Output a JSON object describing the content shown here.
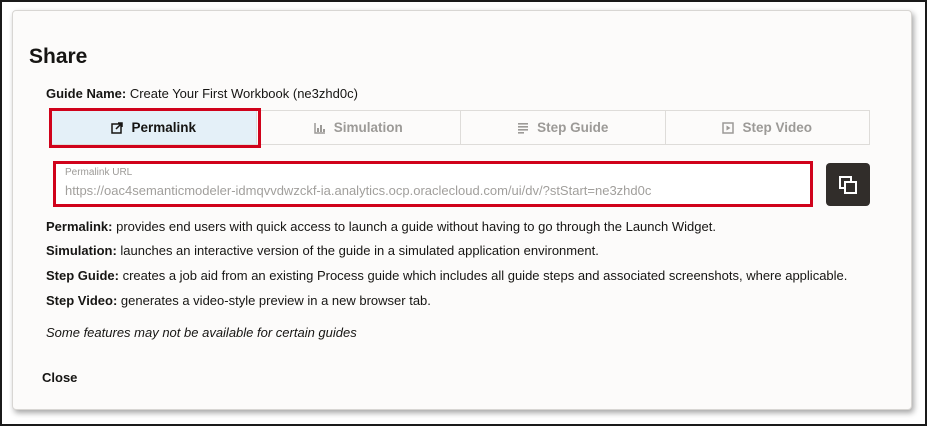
{
  "dialog": {
    "title": "Share",
    "guide_name_label": "Guide Name:",
    "guide_name_value": "Create Your First Workbook (ne3zhd0c)"
  },
  "tabs": [
    {
      "label": "Permalink",
      "icon": "external-link-icon",
      "active": true
    },
    {
      "label": "Simulation",
      "icon": "chart-icon",
      "active": false
    },
    {
      "label": "Step Guide",
      "icon": "lines-icon",
      "active": false
    },
    {
      "label": "Step Video",
      "icon": "video-icon",
      "active": false
    }
  ],
  "permalink": {
    "field_label": "Permalink URL",
    "url": "https://oac4semanticmodeler-idmqvvdwzckf-ia.analytics.ocp.oraclecloud.com/ui/dv/?stStart=ne3zhd0c",
    "copy_icon": "copy-icon"
  },
  "descriptions": [
    {
      "label": "Permalink:",
      "text": "provides end users with quick access to launch a guide without having to go through the Launch Widget."
    },
    {
      "label": "Simulation:",
      "text": "launches an interactive version of the guide in a simulated application environment."
    },
    {
      "label": "Step Guide:",
      "text": "creates a job aid from an existing Process guide which includes all guide steps and associated screenshots, where applicable."
    },
    {
      "label": "Step Video:",
      "text": "generates a video-style preview in a new browser tab."
    }
  ],
  "note": "Some features may not be available for certain guides",
  "close_label": "Close",
  "colors": {
    "highlight": "#d0021b",
    "active_tab_bg": "#e4f0f8",
    "copy_button_bg": "#312d2a",
    "muted_text": "#9c9a97"
  }
}
